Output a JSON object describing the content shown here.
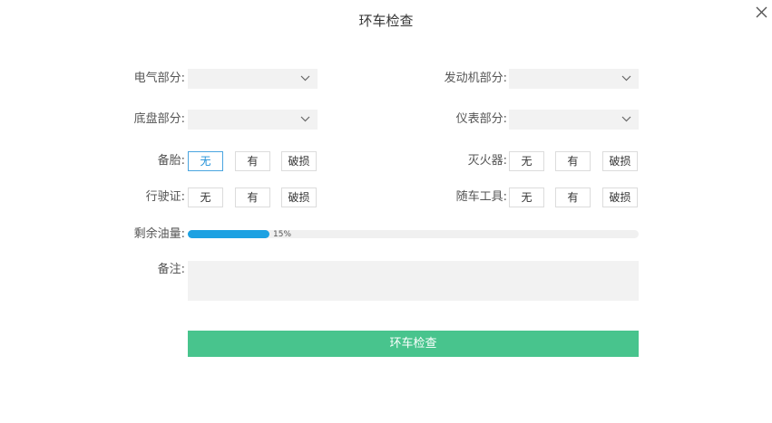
{
  "dialog": {
    "title": "环车检查",
    "close_icon": "close-icon"
  },
  "form": {
    "electrical": {
      "label": "电气部分:",
      "value": ""
    },
    "engine": {
      "label": "发动机部分:",
      "value": ""
    },
    "chassis": {
      "label": "底盘部分:",
      "value": ""
    },
    "instrument": {
      "label": "仪表部分:",
      "value": ""
    },
    "spare_tire": {
      "label": "备胎:",
      "options": [
        "无",
        "有",
        "破损"
      ],
      "selected": "无"
    },
    "extinguisher": {
      "label": "灭火器:",
      "options": [
        "无",
        "有",
        "破损"
      ],
      "selected": ""
    },
    "license": {
      "label": "行驶证:",
      "options": [
        "无",
        "有",
        "破损"
      ],
      "selected": ""
    },
    "tools": {
      "label": "随车工具:",
      "options": [
        "无",
        "有",
        "破损"
      ],
      "selected": ""
    },
    "fuel": {
      "label": "剩余油量:",
      "percent": 15,
      "text": "15%"
    },
    "remark": {
      "label": "备注:",
      "value": ""
    },
    "submit_label": "环车检查"
  },
  "colors": {
    "accent": "#1ca1e2",
    "submit": "#48c48d",
    "field_bg": "#f2f2f2",
    "active_option": "#1e90d8"
  }
}
